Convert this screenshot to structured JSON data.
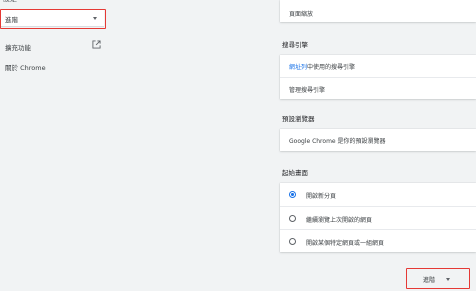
{
  "sidebar": {
    "top_partial_label": "設定",
    "dropdown_label": "進階",
    "items": [
      {
        "label": "擴充功能"
      },
      {
        "label": "關於 Chrome"
      }
    ]
  },
  "main": {
    "appearance_row_label": "頁面縮放",
    "search_engine": {
      "title": "搜尋引擎",
      "row1_link": "網址列",
      "row1_rest": "中使用的搜尋引擎",
      "row2": "管理搜尋引擎"
    },
    "default_browser": {
      "title": "預設瀏覽器",
      "row": "Google Chrome 是你的預設瀏覽器"
    },
    "on_startup": {
      "title": "起始畫面",
      "options": [
        {
          "label": "開啟新分頁",
          "selected": true
        },
        {
          "label": "繼續瀏覽上次開啟的網頁",
          "selected": false
        },
        {
          "label": "開啟某個特定網頁或一組網頁",
          "selected": false
        }
      ]
    },
    "advanced_button_label": "進階"
  },
  "colors": {
    "accent": "#1a73e8",
    "highlight": "#e53935",
    "background": "#f1f3f4"
  }
}
